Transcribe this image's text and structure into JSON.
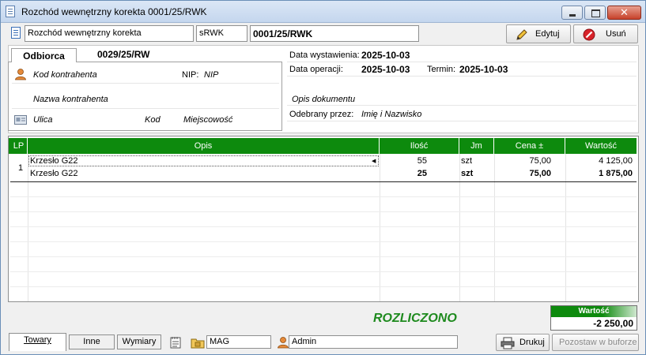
{
  "window": {
    "title": "Rozchód wewnętrzny korekta 0001/25/RWK"
  },
  "header": {
    "doc_type": "Rozchód wewnętrzny korekta",
    "series": "sRWK",
    "number": "0001/25/RWK",
    "edit_label": "Edytuj",
    "delete_label": "Usuń"
  },
  "party": {
    "tab_label": "Odbiorca",
    "doc_ref": "0029/25/RW",
    "code_label": "Kod kontrahenta",
    "nip_label": "NIP:",
    "nip_value": "NIP",
    "name_label": "Nazwa kontrahenta",
    "street_label": "Ulica",
    "postcode_label": "Kod",
    "city_label": "Miejscowość"
  },
  "dates": {
    "issue_label": "Data wystawienia:",
    "issue_value": "2025-10-03",
    "op_label": "Data operacji:",
    "op_value": "2025-10-03",
    "due_label": "Termin:",
    "due_value": "2025-10-03",
    "desc_label": "Opis dokumentu",
    "received_label": "Odebrany przez:",
    "received_value": "Imię i Nazwisko"
  },
  "table": {
    "columns": [
      "LP",
      "Opis",
      "Ilość",
      "Jm",
      "Cena ±",
      "Wartość"
    ],
    "lp": "1",
    "rows": [
      {
        "opis": "Krzesło G22",
        "ilosc": "55",
        "jm": "szt",
        "cena": "75,00",
        "wartosc": "4 125,00"
      },
      {
        "opis": "Krzesło G22",
        "ilosc": "25",
        "jm": "szt",
        "cena": "75,00",
        "wartosc": "1 875,00"
      }
    ]
  },
  "footer": {
    "status": "ROZLICZONO",
    "sum_label": "Wartość",
    "sum_value": "-2 250,00",
    "tab_towary": "Towary",
    "tab_inne": "Inne",
    "tab_wymiary": "Wymiary",
    "warehouse": "MAG",
    "user": "Admin",
    "print_label": "Drukuj",
    "buffer_label": "Pozostaw w buforze"
  },
  "colors": {
    "grid_header": "#0d8a0d",
    "status": "#1e8a1e"
  }
}
